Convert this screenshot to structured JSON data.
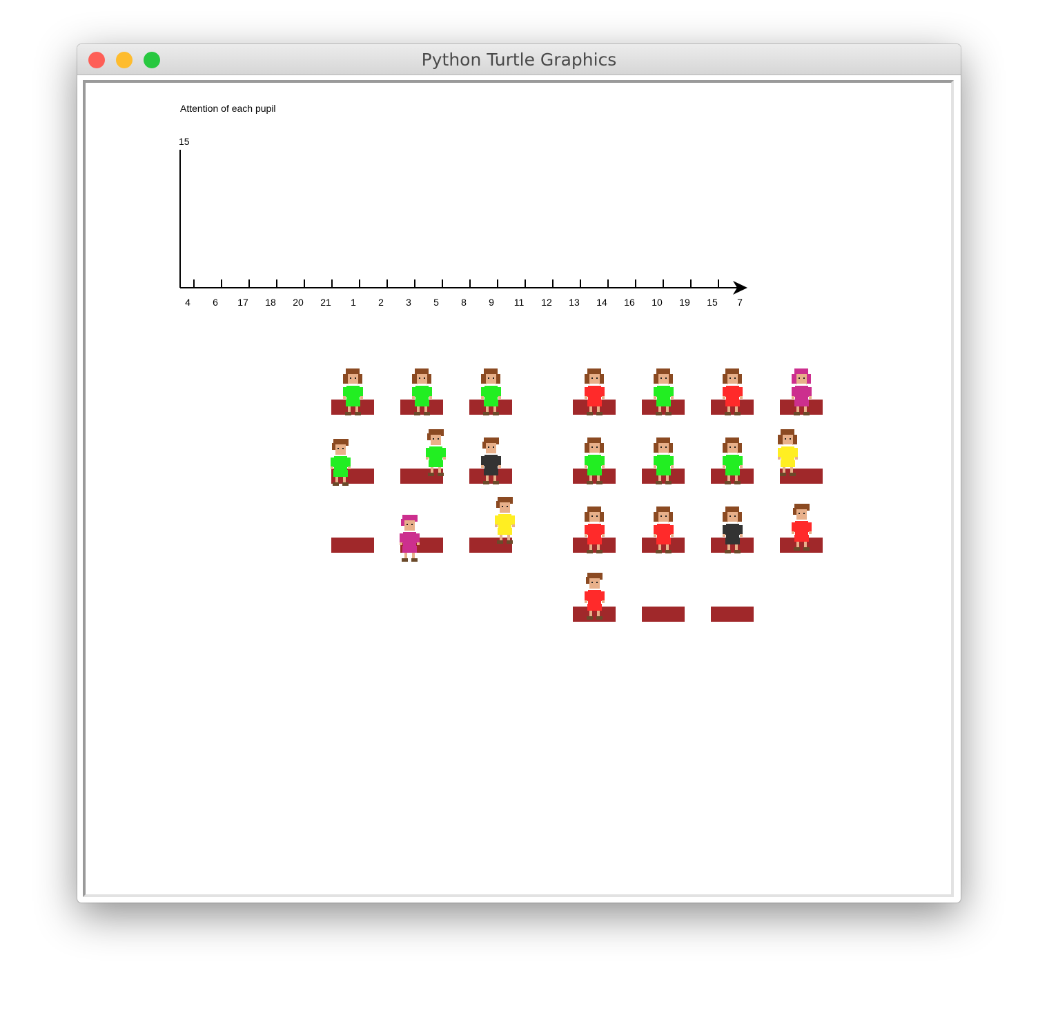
{
  "window": {
    "title": "Python Turtle Graphics",
    "traffic_lights": {
      "close": "#fe5f57",
      "minimize": "#febc2e",
      "zoom": "#28c840"
    }
  },
  "canvas": {
    "chart_title": "Attention of each pupil",
    "y_axis_top_label": "15",
    "x_labels": [
      "4",
      "6",
      "17",
      "18",
      "20",
      "21",
      "1",
      "2",
      "3",
      "5",
      "8",
      "9",
      "11",
      "12",
      "13",
      "14",
      "16",
      "10",
      "19",
      "15",
      "7"
    ]
  },
  "chart_data": {
    "type": "bar",
    "title": "Attention of each pupil",
    "categories": [
      "4",
      "6",
      "17",
      "18",
      "20",
      "21",
      "1",
      "2",
      "3",
      "5",
      "8",
      "9",
      "11",
      "12",
      "13",
      "14",
      "16",
      "10",
      "19",
      "15",
      "7"
    ],
    "ylim": [
      0,
      15
    ]
  },
  "colors": {
    "desk": "#a0282a",
    "hair": "#8b4a22",
    "skin": "#e8b08a",
    "shoes": "#6b4a2a"
  },
  "classroom": {
    "pupils": [
      {
        "sprite": "girl",
        "shirt": "#22ee22"
      },
      {
        "sprite": "girl",
        "shirt": "#22ee22"
      },
      {
        "sprite": "girl",
        "shirt": "#22ee22"
      },
      {
        "sprite": "girl",
        "shirt": "#ff2a2a"
      },
      {
        "sprite": "girl",
        "shirt": "#22ee22"
      },
      {
        "sprite": "girl",
        "shirt": "#ff2a2a"
      },
      {
        "sprite": "girl",
        "shirt": "#cc2f8e",
        "hair": "#cc2f8e"
      },
      {
        "sprite": "boy",
        "shirt": "#22ee22"
      },
      {
        "sprite": "boy",
        "shirt": "#22ee22"
      },
      {
        "sprite": "boy",
        "shirt": "#333333"
      },
      {
        "sprite": "girl",
        "shirt": "#22ee22"
      },
      {
        "sprite": "girl",
        "shirt": "#22ee22"
      },
      {
        "sprite": "girl",
        "shirt": "#22ee22"
      },
      {
        "sprite": "girl",
        "shirt": "#ffee22"
      },
      {
        "sprite": "boy",
        "shirt": "#cc2f8e",
        "hair": "#cc2f8e"
      },
      {
        "sprite": "boy",
        "shirt": "#ffee22"
      },
      {
        "sprite": "girl",
        "shirt": "#ff2a2a"
      },
      {
        "sprite": "girl",
        "shirt": "#ff2a2a"
      },
      {
        "sprite": "girl",
        "shirt": "#333333"
      },
      {
        "sprite": "boy",
        "shirt": "#ff2a2a"
      },
      {
        "sprite": "boy",
        "shirt": "#ff2a2a"
      }
    ]
  }
}
